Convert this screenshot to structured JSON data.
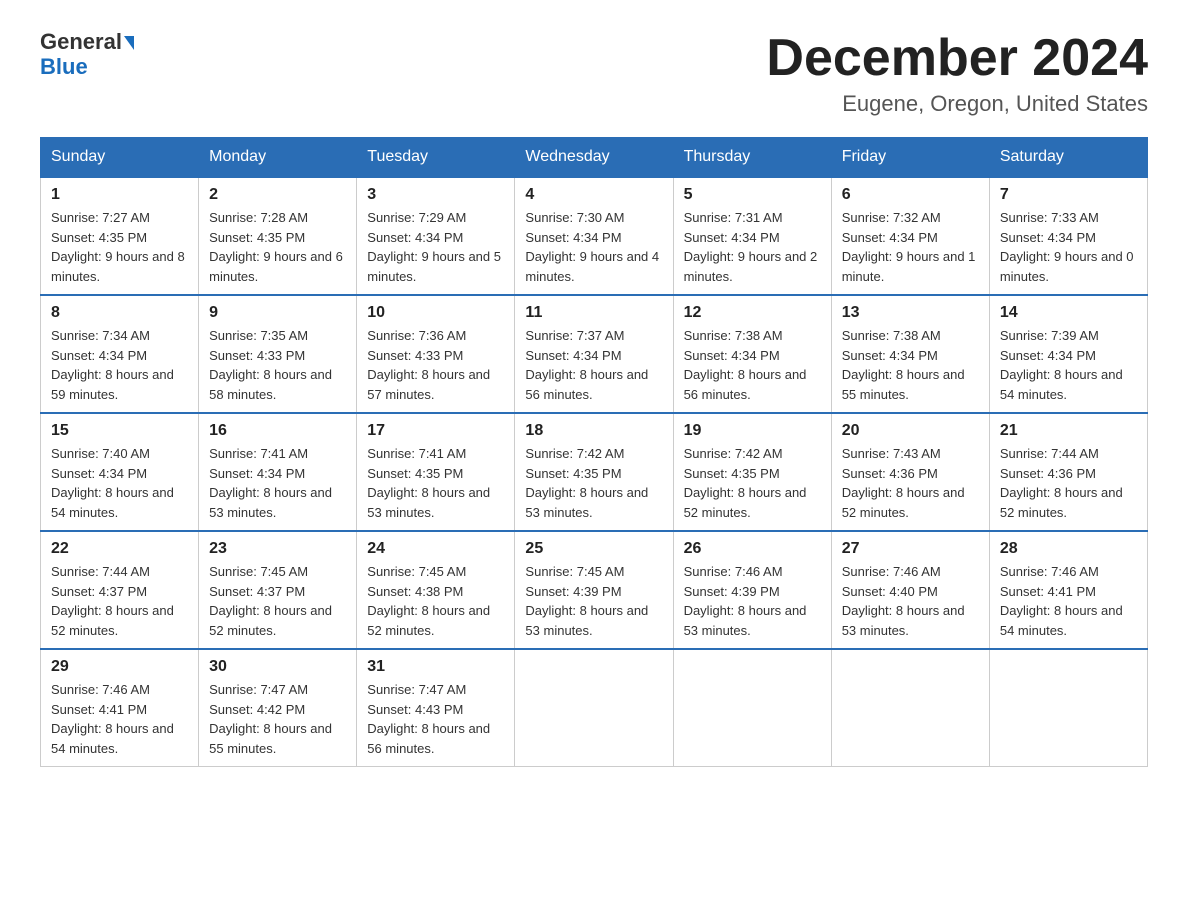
{
  "header": {
    "logo_general": "General",
    "logo_blue": "Blue",
    "month_title": "December 2024",
    "location": "Eugene, Oregon, United States"
  },
  "days_of_week": [
    "Sunday",
    "Monday",
    "Tuesday",
    "Wednesday",
    "Thursday",
    "Friday",
    "Saturday"
  ],
  "weeks": [
    [
      {
        "day": "1",
        "sunrise": "7:27 AM",
        "sunset": "4:35 PM",
        "daylight": "9 hours and 8 minutes."
      },
      {
        "day": "2",
        "sunrise": "7:28 AM",
        "sunset": "4:35 PM",
        "daylight": "9 hours and 6 minutes."
      },
      {
        "day": "3",
        "sunrise": "7:29 AM",
        "sunset": "4:34 PM",
        "daylight": "9 hours and 5 minutes."
      },
      {
        "day": "4",
        "sunrise": "7:30 AM",
        "sunset": "4:34 PM",
        "daylight": "9 hours and 4 minutes."
      },
      {
        "day": "5",
        "sunrise": "7:31 AM",
        "sunset": "4:34 PM",
        "daylight": "9 hours and 2 minutes."
      },
      {
        "day": "6",
        "sunrise": "7:32 AM",
        "sunset": "4:34 PM",
        "daylight": "9 hours and 1 minute."
      },
      {
        "day": "7",
        "sunrise": "7:33 AM",
        "sunset": "4:34 PM",
        "daylight": "9 hours and 0 minutes."
      }
    ],
    [
      {
        "day": "8",
        "sunrise": "7:34 AM",
        "sunset": "4:34 PM",
        "daylight": "8 hours and 59 minutes."
      },
      {
        "day": "9",
        "sunrise": "7:35 AM",
        "sunset": "4:33 PM",
        "daylight": "8 hours and 58 minutes."
      },
      {
        "day": "10",
        "sunrise": "7:36 AM",
        "sunset": "4:33 PM",
        "daylight": "8 hours and 57 minutes."
      },
      {
        "day": "11",
        "sunrise": "7:37 AM",
        "sunset": "4:34 PM",
        "daylight": "8 hours and 56 minutes."
      },
      {
        "day": "12",
        "sunrise": "7:38 AM",
        "sunset": "4:34 PM",
        "daylight": "8 hours and 56 minutes."
      },
      {
        "day": "13",
        "sunrise": "7:38 AM",
        "sunset": "4:34 PM",
        "daylight": "8 hours and 55 minutes."
      },
      {
        "day": "14",
        "sunrise": "7:39 AM",
        "sunset": "4:34 PM",
        "daylight": "8 hours and 54 minutes."
      }
    ],
    [
      {
        "day": "15",
        "sunrise": "7:40 AM",
        "sunset": "4:34 PM",
        "daylight": "8 hours and 54 minutes."
      },
      {
        "day": "16",
        "sunrise": "7:41 AM",
        "sunset": "4:34 PM",
        "daylight": "8 hours and 53 minutes."
      },
      {
        "day": "17",
        "sunrise": "7:41 AM",
        "sunset": "4:35 PM",
        "daylight": "8 hours and 53 minutes."
      },
      {
        "day": "18",
        "sunrise": "7:42 AM",
        "sunset": "4:35 PM",
        "daylight": "8 hours and 53 minutes."
      },
      {
        "day": "19",
        "sunrise": "7:42 AM",
        "sunset": "4:35 PM",
        "daylight": "8 hours and 52 minutes."
      },
      {
        "day": "20",
        "sunrise": "7:43 AM",
        "sunset": "4:36 PM",
        "daylight": "8 hours and 52 minutes."
      },
      {
        "day": "21",
        "sunrise": "7:44 AM",
        "sunset": "4:36 PM",
        "daylight": "8 hours and 52 minutes."
      }
    ],
    [
      {
        "day": "22",
        "sunrise": "7:44 AM",
        "sunset": "4:37 PM",
        "daylight": "8 hours and 52 minutes."
      },
      {
        "day": "23",
        "sunrise": "7:45 AM",
        "sunset": "4:37 PM",
        "daylight": "8 hours and 52 minutes."
      },
      {
        "day": "24",
        "sunrise": "7:45 AM",
        "sunset": "4:38 PM",
        "daylight": "8 hours and 52 minutes."
      },
      {
        "day": "25",
        "sunrise": "7:45 AM",
        "sunset": "4:39 PM",
        "daylight": "8 hours and 53 minutes."
      },
      {
        "day": "26",
        "sunrise": "7:46 AM",
        "sunset": "4:39 PM",
        "daylight": "8 hours and 53 minutes."
      },
      {
        "day": "27",
        "sunrise": "7:46 AM",
        "sunset": "4:40 PM",
        "daylight": "8 hours and 53 minutes."
      },
      {
        "day": "28",
        "sunrise": "7:46 AM",
        "sunset": "4:41 PM",
        "daylight": "8 hours and 54 minutes."
      }
    ],
    [
      {
        "day": "29",
        "sunrise": "7:46 AM",
        "sunset": "4:41 PM",
        "daylight": "8 hours and 54 minutes."
      },
      {
        "day": "30",
        "sunrise": "7:47 AM",
        "sunset": "4:42 PM",
        "daylight": "8 hours and 55 minutes."
      },
      {
        "day": "31",
        "sunrise": "7:47 AM",
        "sunset": "4:43 PM",
        "daylight": "8 hours and 56 minutes."
      },
      null,
      null,
      null,
      null
    ]
  ],
  "labels": {
    "sunrise": "Sunrise: ",
    "sunset": "Sunset: ",
    "daylight": "Daylight: "
  }
}
